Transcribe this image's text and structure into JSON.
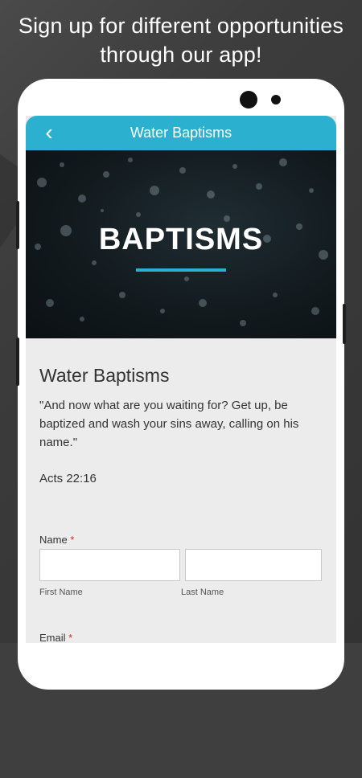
{
  "promo": {
    "headline_line1": "Sign up for different opportunities",
    "headline_line2": "through our app!"
  },
  "appbar": {
    "back_icon": "‹",
    "title": "Water Baptisms",
    "color": "#2bb0cf"
  },
  "hero": {
    "title": "BAPTISMS"
  },
  "content": {
    "title": "Water Baptisms",
    "quote": "\"And now what are you waiting for? Get up, be baptized and wash your sins away, calling on his name.\"",
    "reference": "Acts 22:16"
  },
  "form": {
    "name_label": "Name",
    "required_mark": "*",
    "first_name_value": "",
    "last_name_value": "",
    "first_name_sublabel": "First Name",
    "last_name_sublabel": "Last Name",
    "email_label": "Email"
  }
}
